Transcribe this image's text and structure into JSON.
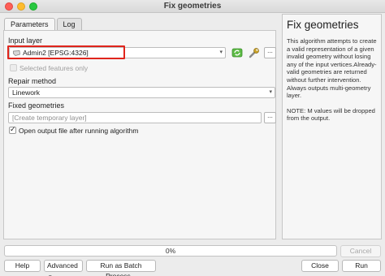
{
  "window": {
    "title": "Fix geometries"
  },
  "tabs": [
    {
      "label": "Parameters",
      "active": true
    },
    {
      "label": "Log",
      "active": false
    }
  ],
  "form": {
    "input_layer_label": "Input layer",
    "input_layer_value": "Admin2 [EPSG:4326]",
    "selected_features_label": "Selected features only",
    "selected_features_checked": false,
    "selected_features_enabled": false,
    "repair_method_label": "Repair method",
    "repair_method_value": "Linework",
    "fixed_geometries_label": "Fixed geometries",
    "fixed_geometries_placeholder": "[Create temporary layer]",
    "open_output_label": "Open output file after running algorithm",
    "open_output_checked": true,
    "dots": "..."
  },
  "help": {
    "title": "Fix geometries",
    "paragraph1": "This algorithm attempts to create a valid representation of a given invalid geometry without losing any of the input vertices.Already-valid geometries are returned without further intervention. Always outputs multi-geometry layer.",
    "paragraph2": "NOTE: M values will be dropped from the output."
  },
  "progress": {
    "value": 0,
    "text": "0%"
  },
  "buttons": {
    "cancel": "Cancel",
    "help": "Help",
    "advanced": "Advanced",
    "batch": "Run as Batch Process...",
    "close": "Close",
    "run": "Run"
  },
  "icons": {
    "layer": "polygon-layer-icon",
    "iterate": "iterate-features-icon",
    "settings": "wrench-settings-icon",
    "dropdown": "chevron-down-icon"
  },
  "colors": {
    "highlight": "#e0251c",
    "iterate_green": "#4caf3a"
  }
}
